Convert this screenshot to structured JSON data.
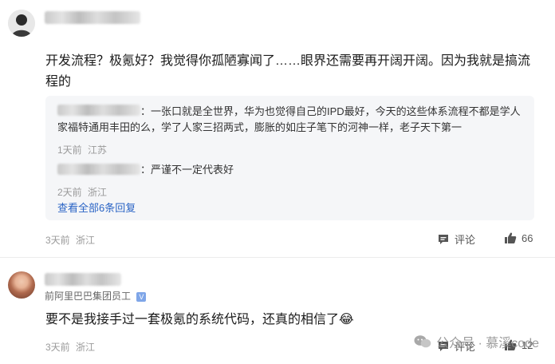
{
  "comment1": {
    "text": "开发流程？极氪好？我觉得你孤陋寡闻了……眼界还需要再开阔开阔。因为我就是搞流程的",
    "time": "3天前",
    "location": "浙江",
    "comment_label": "评论",
    "likes": "66",
    "replies": [
      {
        "suffix": "：一张口就是全世界，华为也觉得自己的IPD最好，今天的这些体系流程不都是学人家福特通用丰田的么，学了人家三招两式，膨胀的如庄子笔下的河神一样，老子天下第一",
        "time": "1天前",
        "location": "江苏"
      },
      {
        "suffix": "：严谨不一定代表好",
        "time": "2天前",
        "location": "浙江"
      }
    ],
    "view_all": "查看全部6条回复"
  },
  "comment2": {
    "user_tag": "前阿里巴巴集团员工",
    "verified_mark": "V",
    "text": "要不是我接手过一套极氪的系统代码，还真的相信了",
    "emoji": "😂",
    "time": "3天前",
    "location": "浙江",
    "comment_label": "评论",
    "likes": "12"
  },
  "watermark": {
    "text": "公众号 · 慕溪code"
  },
  "icons": {
    "comment": "comment-icon",
    "like": "thumbs-up-icon",
    "wechat": "wechat-icon"
  }
}
